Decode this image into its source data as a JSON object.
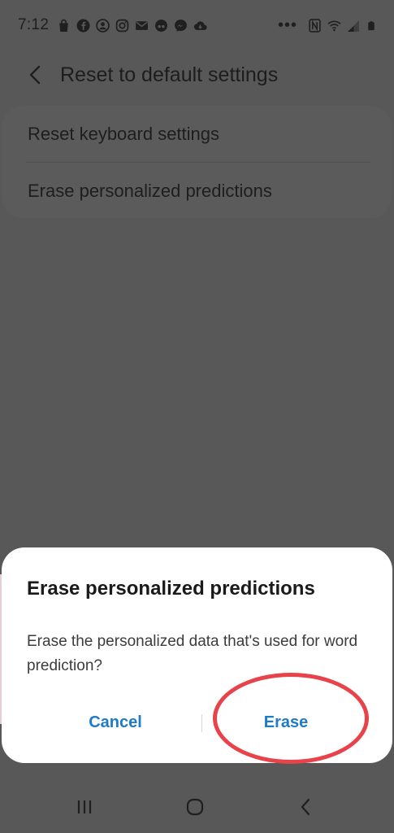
{
  "status_bar": {
    "time": "7:12",
    "icons": [
      "shopping-bag-icon",
      "facebook-icon",
      "account-icon",
      "instagram-icon",
      "mail-icon",
      "app-icon",
      "messenger-icon",
      "cloud-icon"
    ],
    "overflow": "•••",
    "right_icons": [
      "nfc-icon",
      "wifi-icon",
      "signal-icon",
      "battery-icon"
    ]
  },
  "header": {
    "title": "Reset to default settings"
  },
  "settings": {
    "items": [
      {
        "label": "Reset keyboard settings"
      },
      {
        "label": "Erase personalized predictions"
      }
    ]
  },
  "dialog": {
    "title": "Erase personalized predictions",
    "message": "Erase the personalized data that's used for word prediction?",
    "cancel_label": "Cancel",
    "erase_label": "Erase"
  },
  "colors": {
    "accent": "#1f7bc6",
    "annotation": "#e8424a",
    "scrim": "#585858"
  }
}
